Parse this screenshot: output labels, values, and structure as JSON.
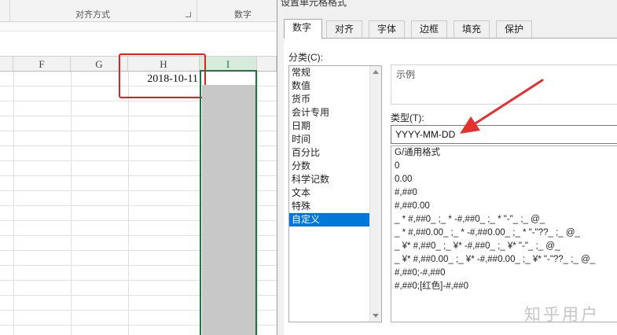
{
  "ribbon": {
    "groups": [
      "对齐方式",
      "数字"
    ]
  },
  "sheet": {
    "columns": [
      "F",
      "G",
      "H",
      "I"
    ],
    "active_cell_value": "2018-10-11"
  },
  "dialog": {
    "title": "设置单元格格式",
    "tabs": [
      "数字",
      "对齐",
      "字体",
      "边框",
      "填充",
      "保护"
    ],
    "active_tab": "数字",
    "category_label": "分类(C):",
    "categories": [
      "常规",
      "数值",
      "货币",
      "会计专用",
      "日期",
      "时间",
      "百分比",
      "分数",
      "科学记数",
      "文本",
      "特殊",
      "自定义"
    ],
    "selected_category": "自定义",
    "sample_label": "示例",
    "type_label": "类型(T):",
    "type_value": "YYYY-MM-DD",
    "formats": [
      "G/通用格式",
      "0",
      "0.00",
      "#,##0",
      "#,##0.00",
      "_ * #,##0_ ;_ * -#,##0_ ;_ * \"-\"_ ;_ @_",
      "_ * #,##0.00_ ;_ * -#,##0.00_ ;_ * \"-\"??_ ;_ @_",
      "_ ¥* #,##0_ ;_ ¥* -#,##0_ ;_ ¥* \"-\"_ ;_ @_",
      "_ ¥* #,##0.00_ ;_ ¥* -#,##0.00_ ;_ ¥* \"-\"??_ ;_ @_",
      "#,##0;-#,##0",
      "#,##0;[红色]-#,##0"
    ]
  },
  "watermark": "知乎用户",
  "colors": {
    "excel_green": "#217346",
    "highlight_red": "#e02020",
    "selection_blue": "#0078d7"
  }
}
